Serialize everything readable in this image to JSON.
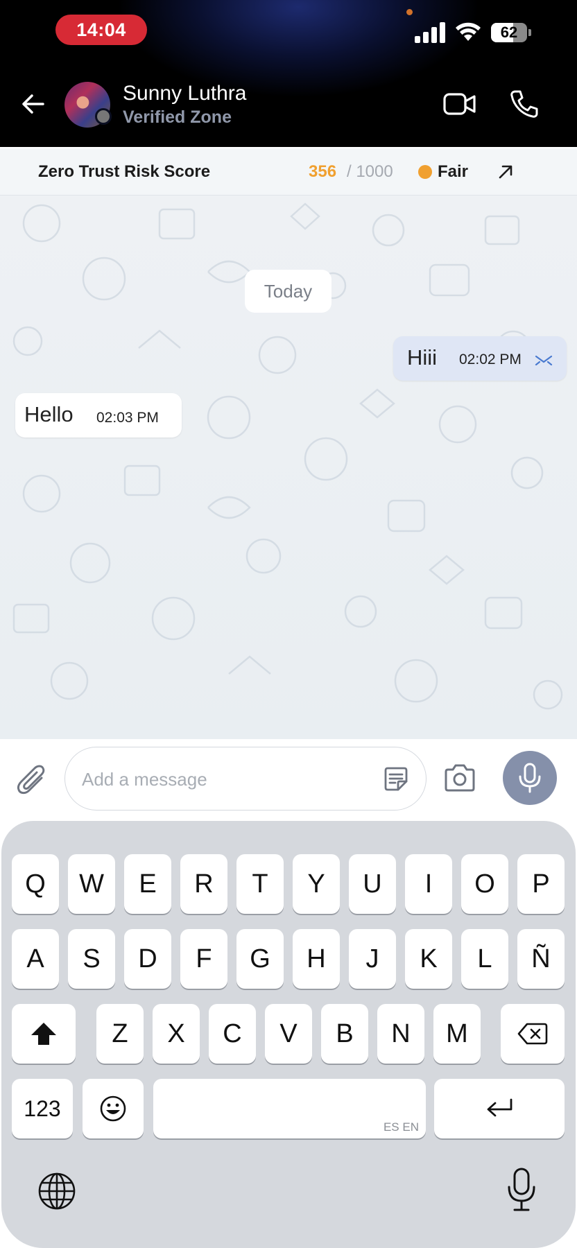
{
  "status_bar": {
    "time": "14:04",
    "battery": "62",
    "battery_level": 0.62
  },
  "header": {
    "contact_name": "Sunny Luthra",
    "contact_subtitle": "Verified Zone"
  },
  "risk_bar": {
    "label": "Zero Trust Risk Score",
    "score": "356",
    "max": " / 1000",
    "status": "Fair",
    "status_color": "#f0a030"
  },
  "chat": {
    "date_separator": "Today",
    "messages": [
      {
        "direction": "outgoing",
        "text": "Hiii",
        "time": "02:02 PM"
      },
      {
        "direction": "incoming",
        "text": "Hello",
        "time": "02:03 PM"
      }
    ]
  },
  "composer": {
    "placeholder": "Add a message"
  },
  "keyboard": {
    "row1": [
      "Q",
      "W",
      "E",
      "R",
      "T",
      "Y",
      "U",
      "I",
      "O",
      "P"
    ],
    "row2": [
      "A",
      "S",
      "D",
      "F",
      "G",
      "H",
      "J",
      "K",
      "L",
      "Ñ"
    ],
    "row3": [
      "Z",
      "X",
      "C",
      "V",
      "B",
      "N",
      "M"
    ],
    "numbers_key": "123",
    "space_language": "ES EN"
  },
  "colors": {
    "accent_red": "#d72a35",
    "outgoing_bubble": "#dfe6f5",
    "mic_button": "#8590aa"
  }
}
